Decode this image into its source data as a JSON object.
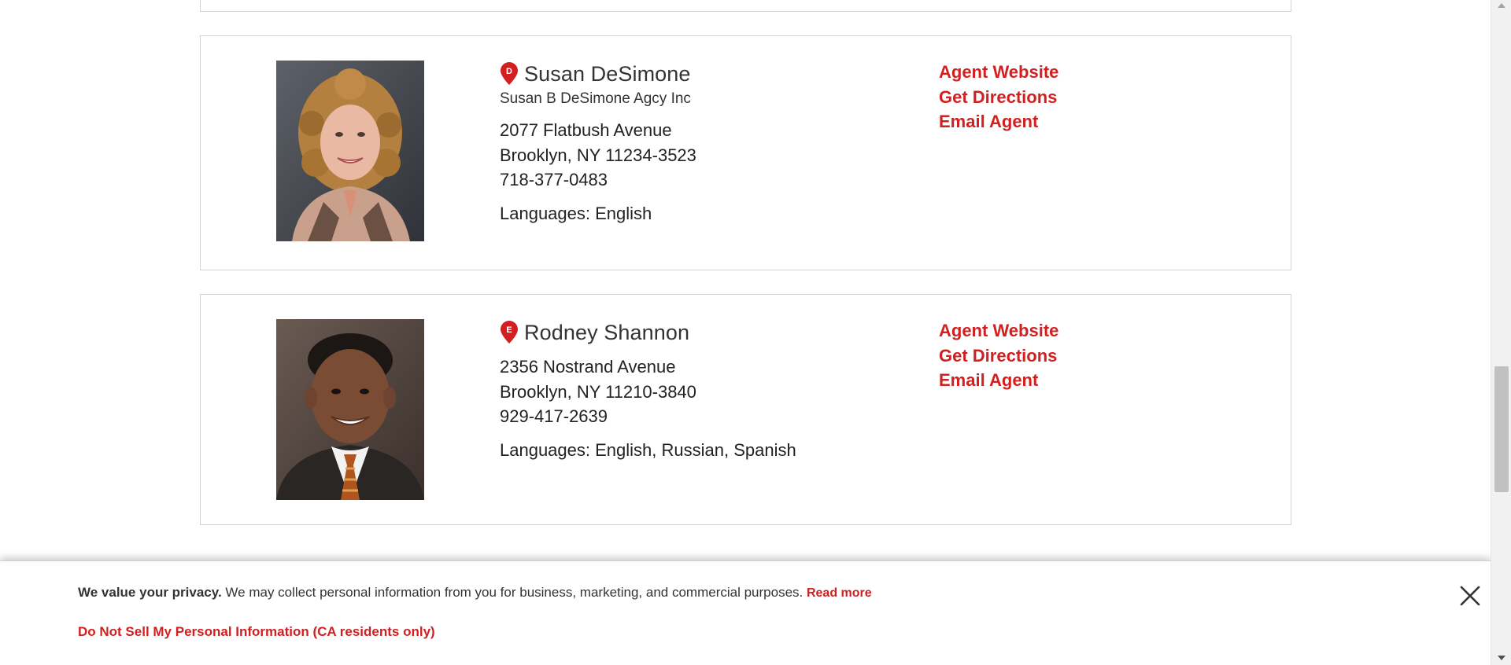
{
  "agents": [
    {
      "pin_letter": "D",
      "name": "Susan DeSimone",
      "agency": "Susan B DeSimone Agcy Inc",
      "address_line1": "2077 Flatbush Avenue",
      "address_line2": "Brooklyn, NY 11234-3523",
      "phone": "718-377-0483",
      "languages": "Languages: English",
      "links": {
        "website": "Agent Website",
        "directions": "Get Directions",
        "email": "Email Agent"
      }
    },
    {
      "pin_letter": "E",
      "name": "Rodney Shannon",
      "address_line1": "2356 Nostrand Avenue",
      "address_line2": "Brooklyn, NY 11210-3840",
      "phone": "929-417-2639",
      "languages": "Languages: English, Russian, Spanish",
      "links": {
        "website": "Agent Website",
        "directions": "Get Directions",
        "email": "Email Agent"
      }
    }
  ],
  "privacy_banner": {
    "heading": "We value your privacy.",
    "message": " We may collect personal information from you for business, marketing, and commercial purposes. ",
    "read_more": "Read more",
    "do_not_sell": "Do Not Sell My Personal Information (CA residents only)",
    "close_icon": "close-icon"
  },
  "colors": {
    "accent_red": "#d21f1f",
    "card_border": "#d3d3d3",
    "text": "#222222"
  }
}
